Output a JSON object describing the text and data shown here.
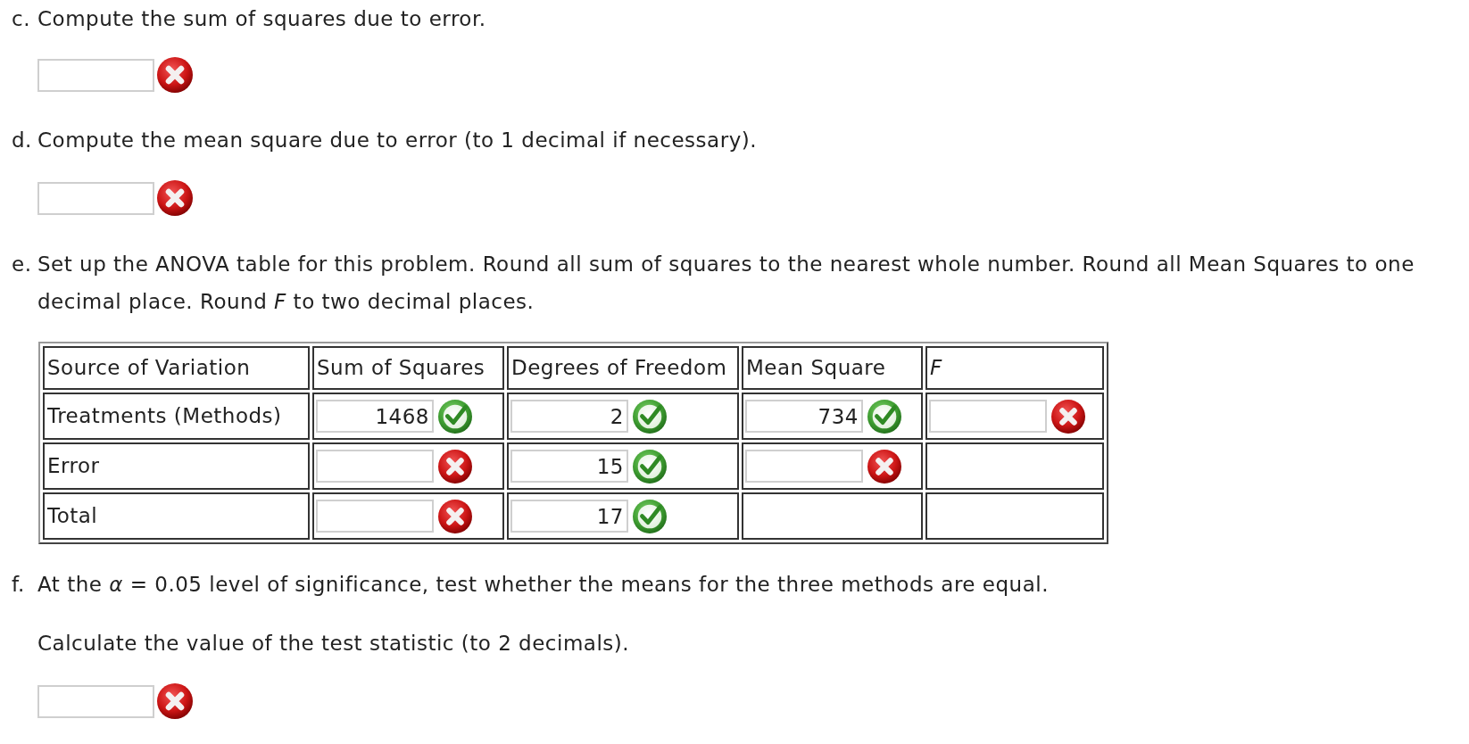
{
  "parts": [
    {
      "label": "c.",
      "text": "Compute the sum of squares due to error.",
      "answer": {
        "correct": false
      }
    },
    {
      "label": "d.",
      "text": "Compute the mean square due to error (to 1 decimal if necessary).",
      "answer": {
        "correct": false
      }
    },
    {
      "label": "e.",
      "text": "Set up the ANOVA table for this problem. Round all sum of squares to the nearest whole number. Round all Mean Squares to one decimal place. Round *F* to two decimal places.",
      "table": {
        "columns": [
          {
            "label": "Source of Variation",
            "kind": "text"
          },
          {
            "label": "Sum of Squares",
            "kind": "text"
          },
          {
            "label": "Degrees of Freedom",
            "kind": "text"
          },
          {
            "label": "Mean Square",
            "kind": "text"
          },
          {
            "label": "F",
            "kind": "symbol"
          }
        ],
        "rows": [
          {
            "cells": [
              {
                "kind": "label",
                "text": "Treatments (Methods)"
              },
              {
                "kind": "input",
                "value": "1468",
                "correct": true
              },
              {
                "kind": "input",
                "value": "2",
                "correct": true
              },
              {
                "kind": "input",
                "value": "734",
                "correct": true
              },
              {
                "kind": "input",
                "correct": false
              }
            ]
          },
          {
            "cells": [
              {
                "kind": "label",
                "text": "Error"
              },
              {
                "kind": "input",
                "correct": false
              },
              {
                "kind": "input",
                "value": "15",
                "correct": true
              },
              {
                "kind": "input",
                "correct": false
              },
              {
                "kind": "empty"
              }
            ]
          },
          {
            "cells": [
              {
                "kind": "label",
                "text": "Total"
              },
              {
                "kind": "input",
                "correct": false
              },
              {
                "kind": "input",
                "value": "17",
                "correct": true
              },
              {
                "kind": "empty"
              },
              {
                "kind": "empty"
              }
            ]
          }
        ]
      }
    },
    {
      "label": "f.",
      "text": "At the *α* = 0.05 level of significance, test whether the means for the three methods are equal.",
      "instruction": "Calculate the value of the test statistic (to 2 decimals).",
      "answer": {
        "correct": false
      }
    }
  ]
}
